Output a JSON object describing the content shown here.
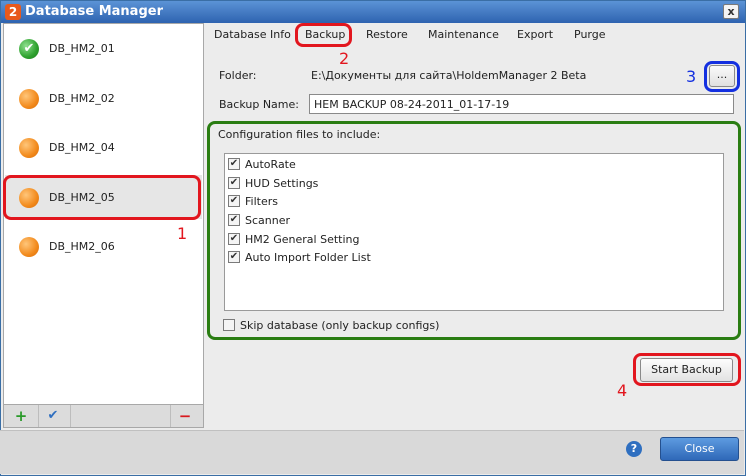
{
  "window": {
    "title": "Database Manager",
    "app_icon": "2",
    "close_glyph": "x"
  },
  "databases": [
    {
      "name": "DB_HM2_01",
      "status": "check",
      "glyph": "✔"
    },
    {
      "name": "DB_HM2_02",
      "status": "orange"
    },
    {
      "name": "DB_HM2_04",
      "status": "orange"
    },
    {
      "name": "DB_HM2_05",
      "status": "orange",
      "selected": true
    },
    {
      "name": "DB_HM2_06",
      "status": "orange"
    }
  ],
  "left_toolbar": {
    "add": "+",
    "check": "✔",
    "remove": "−"
  },
  "tabs": [
    "Database Info",
    "Backup",
    "Restore",
    "Maintenance",
    "Export",
    "Purge"
  ],
  "backup": {
    "folder_label": "Folder:",
    "folder_path": "E:\\Документы для сайта\\HoldemManager 2 Beta",
    "browse_label": "...",
    "name_label": "Backup Name:",
    "name_value": "HEM BACKUP 08-24-2011_01-17-19",
    "config_title": "Configuration files to include:",
    "configs": [
      {
        "label": "AutoRate",
        "checked": true
      },
      {
        "label": "HUD Settings",
        "checked": true
      },
      {
        "label": "Filters",
        "checked": true
      },
      {
        "label": "Scanner",
        "checked": true
      },
      {
        "label": "HM2 General Setting",
        "checked": true
      },
      {
        "label": "Auto Import Folder List",
        "checked": true
      }
    ],
    "check_glyph": "✔",
    "skip_label": "Skip database (only backup configs)",
    "start_label": "Start Backup"
  },
  "footer": {
    "help": "?",
    "close_label": "Close"
  },
  "annotations": {
    "n1": "1",
    "n2": "2",
    "n3": "3",
    "n4": "4"
  },
  "colors": {
    "annotation_red": "#e2161e",
    "annotation_blue": "#1430e0",
    "annotation_green": "#2a7d12",
    "title_bar": "#2e63b0"
  }
}
